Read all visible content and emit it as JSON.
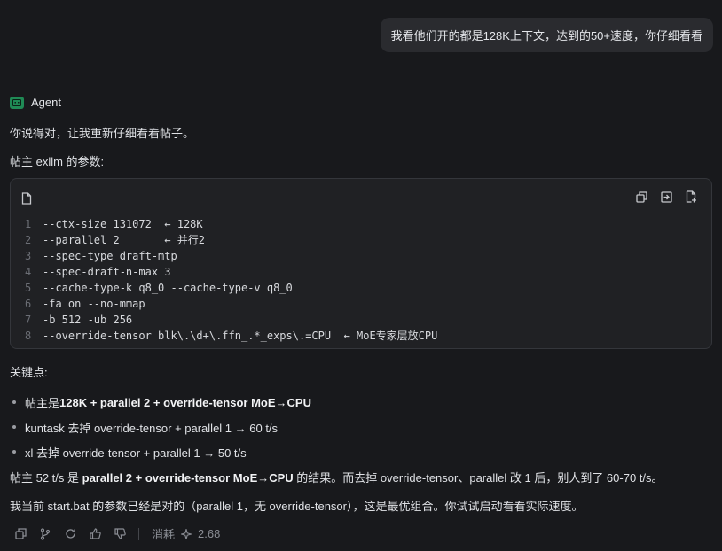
{
  "user_message": "我看他们开的都是128K上下文，达到的50+速度，你仔细看看",
  "agent_name": "Agent",
  "intro": "你说得对，让我重新仔细看看帖子。",
  "params_heading": "帖主 exllm 的参数:",
  "code_lines": [
    {
      "n": "1",
      "t": "--ctx-size 131072  ← 128K"
    },
    {
      "n": "2",
      "t": "--parallel 2       ← 并行2"
    },
    {
      "n": "3",
      "t": "--spec-type draft-mtp"
    },
    {
      "n": "4",
      "t": "--spec-draft-n-max 3"
    },
    {
      "n": "5",
      "t": "--cache-type-k q8_0 --cache-type-v q8_0"
    },
    {
      "n": "6",
      "t": "-fa on --no-mmap"
    },
    {
      "n": "7",
      "t": "-b 512 -ub 256"
    },
    {
      "n": "8",
      "t": "--override-tensor blk\\.\\d+\\.ffn_.*_exps\\.=CPU  ← MoE专家层放CPU"
    }
  ],
  "key_points_heading": "关键点:",
  "bullets": [
    {
      "pre": "帖主是 ",
      "bold": "128K + parallel 2 + override-tensor MoE→CPU",
      "post": ""
    },
    {
      "pre": "kuntask 去掉 override-tensor + parallel 1 → 60 t/s",
      "bold": "",
      "post": ""
    },
    {
      "pre": "xl 去掉 override-tensor + parallel 1 → 50 t/s",
      "bold": "",
      "post": ""
    }
  ],
  "conclusion": {
    "pre": "帖主 52 t/s 是 ",
    "bold": "parallel 2 + override-tensor MoE→CPU",
    "post": " 的结果。而去掉 override-tensor、parallel 改 1 后，别人到了 60-70 t/s。"
  },
  "advice": "我当前 start.bat 的参数已经是对的（parallel 1，无 override-tensor），这是最优组合。你试试启动看看实际速度。",
  "footer": {
    "consume_label": "消耗",
    "consume_value": "2.68",
    "icons": [
      "copy-icon",
      "branch-icon",
      "retry-icon",
      "thumbs-up-icon",
      "thumbs-down-icon"
    ]
  }
}
